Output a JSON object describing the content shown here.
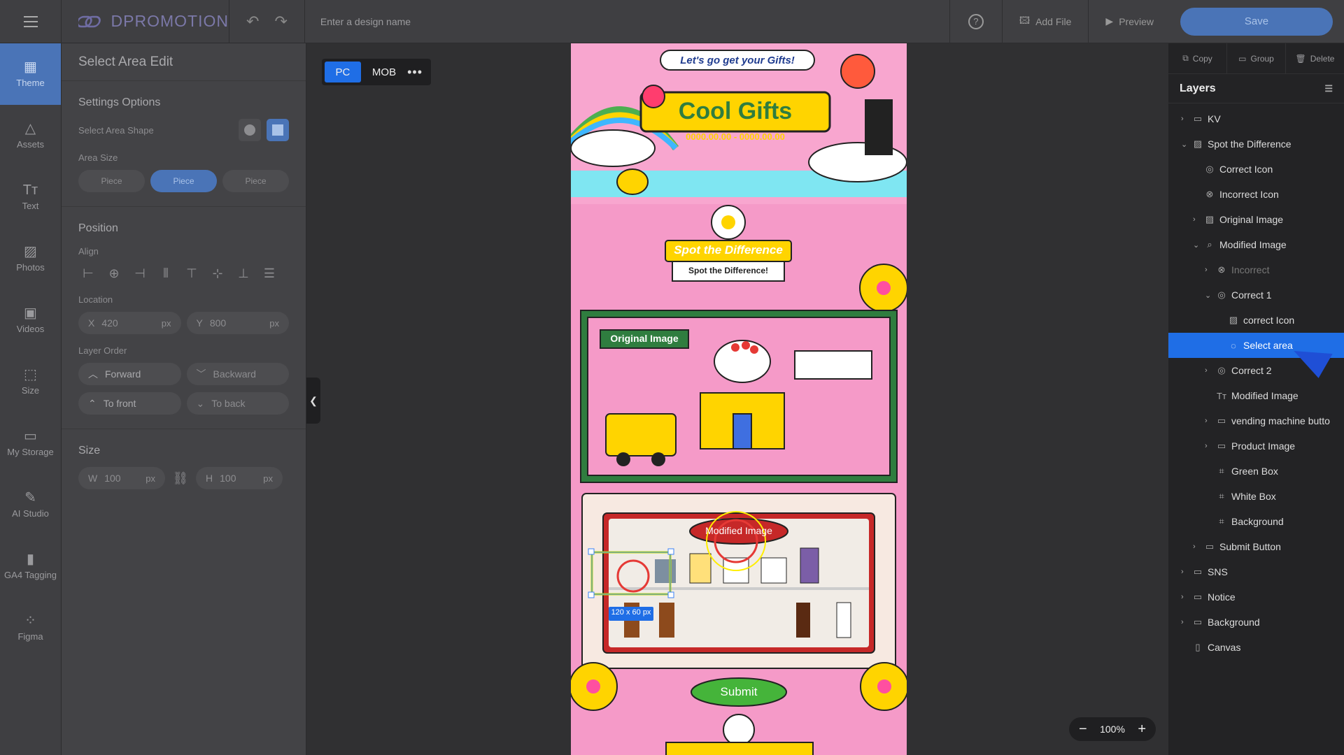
{
  "app": {
    "logo": "DPROMOTION",
    "design_name_placeholder": "Enter a design name",
    "add_file": "Add File",
    "preview": "Preview",
    "save": "Save"
  },
  "sidebar": {
    "items": [
      {
        "label": "Theme",
        "icon": "grid-icon"
      },
      {
        "label": "Assets",
        "icon": "shapes-icon"
      },
      {
        "label": "Text",
        "icon": "text-icon"
      },
      {
        "label": "Photos",
        "icon": "image-icon"
      },
      {
        "label": "Videos",
        "icon": "video-icon"
      },
      {
        "label": "Size",
        "icon": "size-icon"
      },
      {
        "label": "My Storage",
        "icon": "folder-icon"
      },
      {
        "label": "AI Studio",
        "icon": "wand-icon"
      },
      {
        "label": "GA4 Tagging",
        "icon": "chart-icon"
      },
      {
        "label": "Figma",
        "icon": "figma-icon"
      }
    ]
  },
  "panel": {
    "title": "Select Area Edit",
    "settings_heading": "Settings Options",
    "shape_label": "Select Area Shape",
    "area_size_label": "Area Size",
    "area_sizes": [
      "Piece",
      "Piece",
      "Piece"
    ],
    "position_heading": "Position",
    "align_label": "Align",
    "location_label": "Location",
    "x_label": "X",
    "x_value": "420",
    "y_label": "Y",
    "y_value": "800",
    "unit": "px",
    "layer_order_label": "Layer Order",
    "forward": "Forward",
    "backward": "Backward",
    "to_front": "To front",
    "to_back": "To back",
    "size_heading": "Size",
    "w_label": "W",
    "w_value": "100",
    "h_label": "H",
    "h_value": "100"
  },
  "canvas": {
    "pc": "PC",
    "mob": "MOB",
    "zoom": "100%",
    "selection_label": "120 x 60 px"
  },
  "artboard": {
    "tagline": "Let's go get your Gifts!",
    "title": "Cool Gifts",
    "dates": "0000.00.00 - 0000.00.00",
    "banner": "Spot the Difference",
    "banner_sub": "Spot the Difference!",
    "original_label": "Original Image",
    "modified_label": "Modified Image",
    "submit": "Submit"
  },
  "layers": {
    "copy": "Copy",
    "group": "Group",
    "delete": "Delete",
    "title": "Layers",
    "items": [
      {
        "label": "KV",
        "depth": 0,
        "chev": "›",
        "icon": "folder-icon",
        "sel": false,
        "dim": false
      },
      {
        "label": "Spot the Difference",
        "depth": 0,
        "chev": "⌄",
        "icon": "image-icon",
        "sel": false,
        "dim": false
      },
      {
        "label": "Correct Icon",
        "depth": 1,
        "chev": "",
        "icon": "target-icon",
        "sel": false,
        "dim": false
      },
      {
        "label": "Incorrect Icon",
        "depth": 1,
        "chev": "",
        "icon": "x-circle-icon",
        "sel": false,
        "dim": false
      },
      {
        "label": "Original Image",
        "depth": 1,
        "chev": "›",
        "icon": "image-icon",
        "sel": false,
        "dim": false
      },
      {
        "label": "Modified Image",
        "depth": 1,
        "chev": "⌄",
        "icon": "search-icon",
        "sel": false,
        "dim": false
      },
      {
        "label": "Incorrect",
        "depth": 2,
        "chev": "›",
        "icon": "x-circle-icon",
        "sel": false,
        "dim": true
      },
      {
        "label": "Correct 1",
        "depth": 2,
        "chev": "⌄",
        "icon": "target-icon",
        "sel": false,
        "dim": false
      },
      {
        "label": "correct Icon",
        "depth": 3,
        "chev": "",
        "icon": "image-icon",
        "sel": false,
        "dim": false
      },
      {
        "label": "Select area",
        "depth": 3,
        "chev": "",
        "icon": "dashed-circle-icon",
        "sel": true,
        "dim": false
      },
      {
        "label": "Correct 2",
        "depth": 2,
        "chev": "›",
        "icon": "target-icon",
        "sel": false,
        "dim": false
      },
      {
        "label": "Modified Image",
        "depth": 2,
        "chev": "",
        "icon": "text-icon",
        "sel": false,
        "dim": false
      },
      {
        "label": "vending machine butto",
        "depth": 2,
        "chev": "›",
        "icon": "folder-icon",
        "sel": false,
        "dim": false
      },
      {
        "label": "Product Image",
        "depth": 2,
        "chev": "›",
        "icon": "folder-icon",
        "sel": false,
        "dim": false
      },
      {
        "label": "Green Box",
        "depth": 2,
        "chev": "",
        "icon": "frame-icon",
        "sel": false,
        "dim": false
      },
      {
        "label": "White Box",
        "depth": 2,
        "chev": "",
        "icon": "frame-icon",
        "sel": false,
        "dim": false
      },
      {
        "label": "Background",
        "depth": 2,
        "chev": "",
        "icon": "frame-icon",
        "sel": false,
        "dim": false
      },
      {
        "label": "Submit Button",
        "depth": 1,
        "chev": "›",
        "icon": "button-icon",
        "sel": false,
        "dim": false
      },
      {
        "label": "SNS",
        "depth": 0,
        "chev": "›",
        "icon": "folder-icon",
        "sel": false,
        "dim": false
      },
      {
        "label": "Notice",
        "depth": 0,
        "chev": "›",
        "icon": "folder-icon",
        "sel": false,
        "dim": false
      },
      {
        "label": "Background",
        "depth": 0,
        "chev": "›",
        "icon": "folder-icon",
        "sel": false,
        "dim": false
      },
      {
        "label": "Canvas",
        "depth": 0,
        "chev": "",
        "icon": "page-icon",
        "sel": false,
        "dim": false
      }
    ]
  }
}
